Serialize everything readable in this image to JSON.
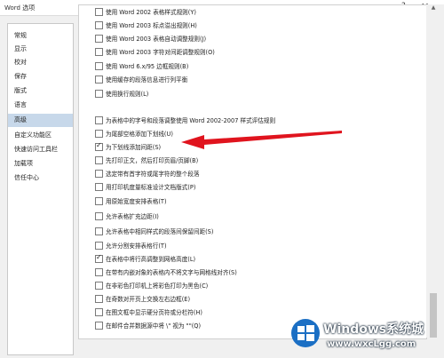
{
  "window": {
    "title": "Word 选项",
    "help_glyph": "?",
    "close_glyph": "✕"
  },
  "sidebar": {
    "items": [
      {
        "label": "常规"
      },
      {
        "label": "显示"
      },
      {
        "label": "校对"
      },
      {
        "label": "保存"
      },
      {
        "label": "版式"
      },
      {
        "label": "语言"
      },
      {
        "label": "高级",
        "selected": true
      },
      {
        "label": "自定义功能区"
      },
      {
        "label": "快速访问工具栏"
      },
      {
        "label": "加载项"
      },
      {
        "label": "信任中心"
      }
    ]
  },
  "options": [
    {
      "label": "使用 Word 2002 表格样式规则(Y)",
      "checked": false
    },
    {
      "label": "使用 Word 2003 标点溢出规则(H)",
      "checked": false
    },
    {
      "label": "使用 Word 2003 表格自动调整规则(J)",
      "checked": false
    },
    {
      "label": "使用 Word 2003 字符对间距调整规则(O)",
      "checked": false
    },
    {
      "label": "使用 Word 6.x/95 边框规则(B)",
      "checked": false
    },
    {
      "label": "使用缓存的段落信息进行列平衡",
      "checked": false
    },
    {
      "label": "使用换行规则(L)",
      "checked": false
    },
    {
      "label": "为表格中的字号和段落调整使用 Word 2002-2007 样式评估规则",
      "checked": false
    },
    {
      "label": "为尾部空格添加下划线(U)",
      "checked": false
    },
    {
      "label": "为下划线添加间距(S)",
      "checked": true
    },
    {
      "label": "先打印正文，然后打印页眉/页脚(B)",
      "checked": false
    },
    {
      "label": "选定带有首字符或尾字符的整个段落",
      "checked": false
    },
    {
      "label": "用打印机度量标准设计文档版式(P)",
      "checked": false
    },
    {
      "label": "用原始宽度安排表格(T)",
      "checked": false
    },
    {
      "label": "允许表格扩充边距(I)",
      "checked": false
    },
    {
      "label": "允许表格中相同样式的段落间保留间距(S)",
      "checked": false
    },
    {
      "label": "允许分割安排表格行(T)",
      "checked": false
    },
    {
      "label": "在表格中将行高调整到网格高度(L)",
      "checked": true
    },
    {
      "label": "在带有内嵌对象的表格内不将文字与网格线对齐(S)",
      "checked": false
    },
    {
      "label": "在非彩色打印机上将彩色打印为黑色(C)",
      "checked": false
    },
    {
      "label": "在奇数对开页上交换左右边框(E)",
      "checked": false
    },
    {
      "label": "在图文框中显示硬分页符或分栏符(H)",
      "checked": false
    },
    {
      "label": "在邮件合并数据源中将 \\\" 视为 \"\"(Q)",
      "checked": false
    }
  ],
  "colors": {
    "selected_bg": "#c7d8ea",
    "arrow": "#e0141e"
  },
  "watermark": {
    "title": "Windows系统城",
    "url": "www.wxcLgg.com"
  }
}
